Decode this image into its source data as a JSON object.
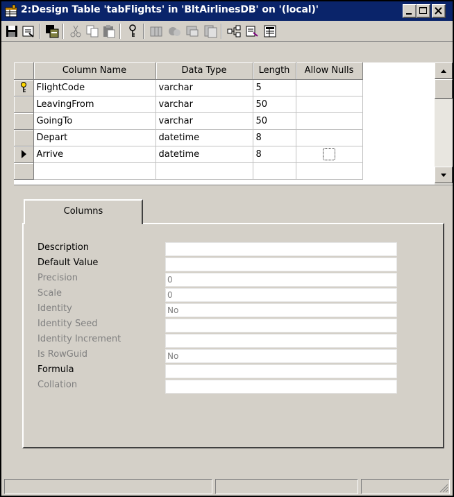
{
  "window": {
    "title": "2:Design Table 'tabFlights' in 'BltAirlinesDB' on '(local)'"
  },
  "toolbar": {
    "buttons": [
      {
        "name": "save-icon"
      },
      {
        "name": "properties-icon"
      },
      {
        "name": "generate-script-icon"
      },
      {
        "name": "cut-icon"
      },
      {
        "name": "copy-icon"
      },
      {
        "name": "paste-icon"
      },
      {
        "name": "primary-key-icon"
      },
      {
        "name": "insert-column-icon"
      },
      {
        "name": "delete-column-icon"
      },
      {
        "name": "manage-relationships-icon"
      },
      {
        "name": "manage-indexes-icon"
      },
      {
        "name": "manage-constraints-icon"
      },
      {
        "name": "manage-triggers-icon"
      },
      {
        "name": "show-diagram-icon"
      }
    ]
  },
  "grid": {
    "headers": [
      "Column Name",
      "Data Type",
      "Length",
      "Allow Nulls"
    ],
    "rows": [
      {
        "name": "FlightCode",
        "type": "varchar",
        "length": "5",
        "pk": true,
        "current": false,
        "nulls": false
      },
      {
        "name": "LeavingFrom",
        "type": "varchar",
        "length": "50",
        "pk": false,
        "current": false,
        "nulls": false
      },
      {
        "name": "GoingTo",
        "type": "varchar",
        "length": "50",
        "pk": false,
        "current": false,
        "nulls": false
      },
      {
        "name": "Depart",
        "type": "datetime",
        "length": "8",
        "pk": false,
        "current": false,
        "nulls": false
      },
      {
        "name": "Arrive",
        "type": "datetime",
        "length": "8",
        "pk": false,
        "current": true,
        "nulls": false
      }
    ]
  },
  "tabs": {
    "columns_label": "Columns"
  },
  "properties": [
    {
      "label": "Description",
      "value": "",
      "enabled": true
    },
    {
      "label": "Default Value",
      "value": "",
      "enabled": true
    },
    {
      "label": "Precision",
      "value": "0",
      "enabled": false
    },
    {
      "label": "Scale",
      "value": "0",
      "enabled": false
    },
    {
      "label": "Identity",
      "value": "No",
      "enabled": false
    },
    {
      "label": "Identity Seed",
      "value": "",
      "enabled": false
    },
    {
      "label": "Identity Increment",
      "value": "",
      "enabled": false
    },
    {
      "label": "Is RowGuid",
      "value": "No",
      "enabled": false
    },
    {
      "label": "Formula",
      "value": "",
      "enabled": true
    },
    {
      "label": "Collation",
      "value": "",
      "enabled": false
    }
  ],
  "colors": {
    "titlebar": "#0a246a",
    "chrome": "#d4d0c8",
    "disabled_text": "#808080"
  }
}
